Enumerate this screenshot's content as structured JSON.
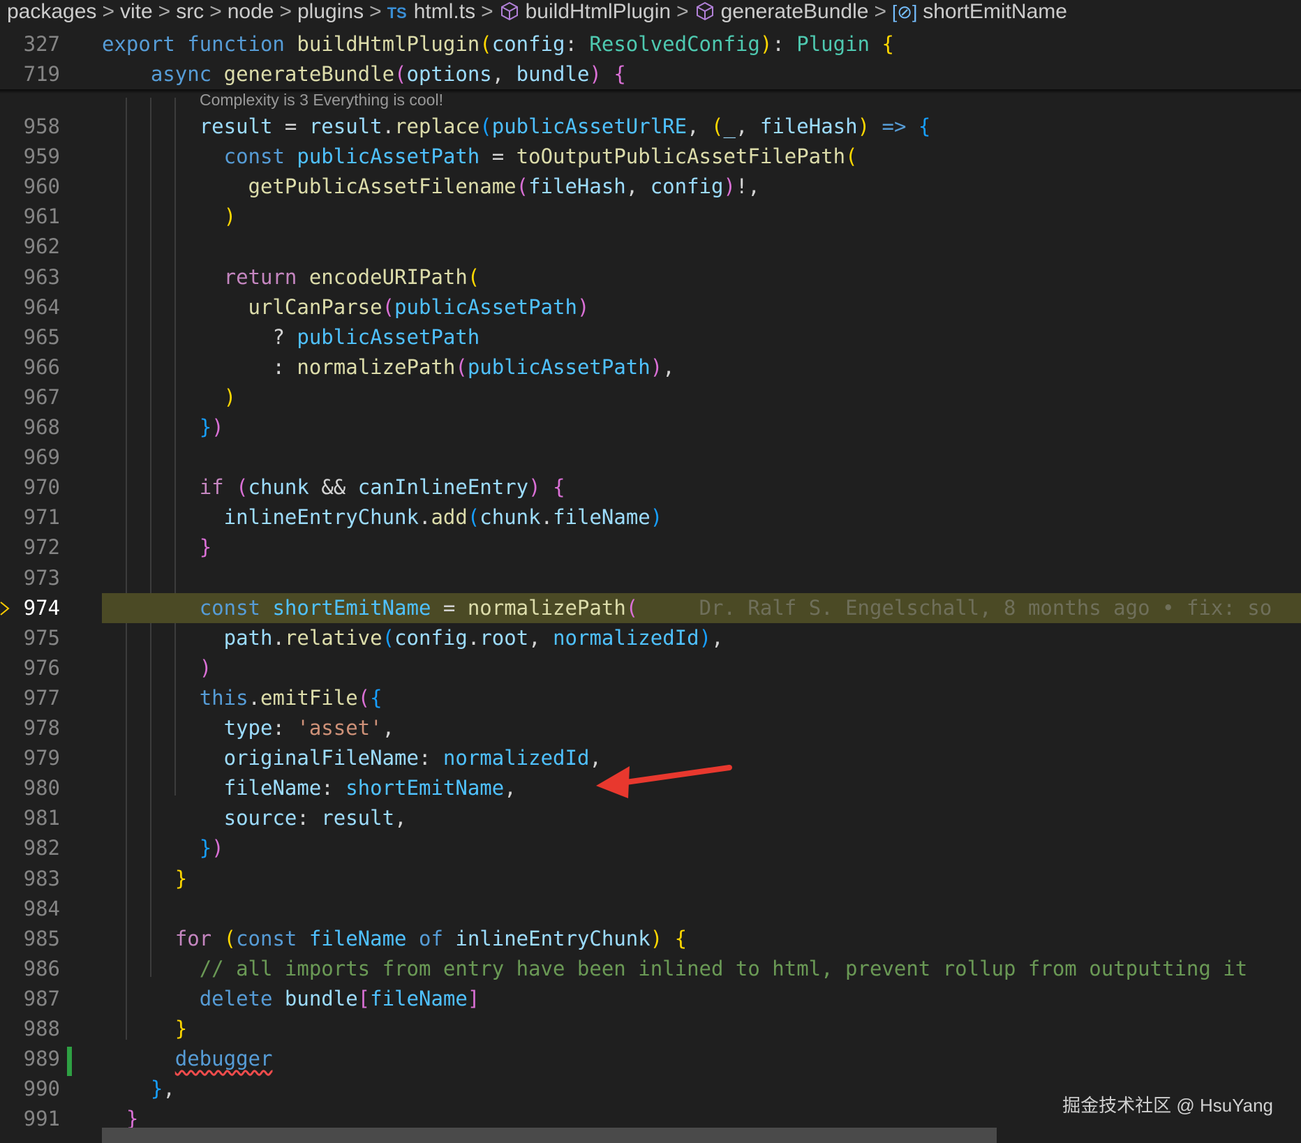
{
  "breadcrumb": {
    "segments": [
      "packages",
      "vite",
      "src",
      "node",
      "plugins",
      "html.ts",
      "buildHtmlPlugin",
      "generateBundle",
      "shortEmitName"
    ],
    "ts_badge": "TS",
    "icons": [
      "",
      "",
      "",
      "",
      "",
      "ts-file-icon",
      "cube-icon",
      "cube-icon",
      "field-icon"
    ]
  },
  "sticky": [
    {
      "num": "327",
      "tokens": [
        [
          "k",
          "export "
        ],
        [
          "k",
          "function "
        ],
        [
          "f",
          "buildHtmlPlugin"
        ],
        [
          "b1",
          "("
        ],
        [
          "v",
          "config"
        ],
        [
          "p",
          ": "
        ],
        [
          "t",
          "ResolvedConfig"
        ],
        [
          "b1",
          ")"
        ],
        [
          "p",
          ": "
        ],
        [
          "t",
          "Plugin "
        ],
        [
          "b1",
          "{"
        ]
      ]
    },
    {
      "num": "719",
      "tokens": [
        [
          "k",
          "async "
        ],
        [
          "f",
          "generateBundle"
        ],
        [
          "b2",
          "("
        ],
        [
          "v",
          "options"
        ],
        [
          "p",
          ", "
        ],
        [
          "v",
          "bundle"
        ],
        [
          "b2",
          ") "
        ],
        [
          "b2",
          "{"
        ]
      ]
    }
  ],
  "codelens": "Complexity is 3 Everything is cool!",
  "lines": [
    {
      "num": "958",
      "tokens": [
        [
          "v",
          "result "
        ],
        [
          "p",
          "= "
        ],
        [
          "v",
          "result"
        ],
        [
          "p",
          "."
        ],
        [
          "f",
          "replace"
        ],
        [
          "b3",
          "("
        ],
        [
          "c",
          "publicAssetUrlRE"
        ],
        [
          "p",
          ", "
        ],
        [
          "b1",
          "("
        ],
        [
          "v",
          "_"
        ],
        [
          "p",
          ", "
        ],
        [
          "v",
          "fileHash"
        ],
        [
          "b1",
          ") "
        ],
        [
          "k",
          "=> "
        ],
        [
          "b3",
          "{"
        ]
      ]
    },
    {
      "num": "959",
      "tokens": [
        [
          "k",
          "const "
        ],
        [
          "c",
          "publicAssetPath "
        ],
        [
          "p",
          "= "
        ],
        [
          "f",
          "toOutputPublicAssetFilePath"
        ],
        [
          "b1",
          "("
        ]
      ]
    },
    {
      "num": "960",
      "tokens": [
        [
          "f",
          "getPublicAssetFilename"
        ],
        [
          "b2",
          "("
        ],
        [
          "v",
          "fileHash"
        ],
        [
          "p",
          ", "
        ],
        [
          "v",
          "config"
        ],
        [
          "b2",
          ")"
        ],
        [
          "p",
          "!,"
        ]
      ]
    },
    {
      "num": "961",
      "tokens": [
        [
          "b1",
          ")"
        ]
      ]
    },
    {
      "num": "962",
      "tokens": []
    },
    {
      "num": "963",
      "tokens": [
        [
          "kp",
          "return "
        ],
        [
          "f",
          "encodeURIPath"
        ],
        [
          "b1",
          "("
        ]
      ]
    },
    {
      "num": "964",
      "tokens": [
        [
          "f",
          "urlCanParse"
        ],
        [
          "b2",
          "("
        ],
        [
          "c",
          "publicAssetPath"
        ],
        [
          "b2",
          ")"
        ]
      ]
    },
    {
      "num": "965",
      "tokens": [
        [
          "p",
          "? "
        ],
        [
          "c",
          "publicAssetPath"
        ]
      ]
    },
    {
      "num": "966",
      "tokens": [
        [
          "p",
          ": "
        ],
        [
          "f",
          "normalizePath"
        ],
        [
          "b2",
          "("
        ],
        [
          "c",
          "publicAssetPath"
        ],
        [
          "b2",
          ")"
        ],
        [
          "p",
          ","
        ]
      ]
    },
    {
      "num": "967",
      "tokens": [
        [
          "b1",
          ")"
        ]
      ]
    },
    {
      "num": "968",
      "tokens": [
        [
          "b3",
          "}"
        ],
        [
          "b2",
          ")"
        ]
      ]
    },
    {
      "num": "969",
      "tokens": []
    },
    {
      "num": "970",
      "tokens": [
        [
          "kp",
          "if "
        ],
        [
          "b2",
          "("
        ],
        [
          "v",
          "chunk "
        ],
        [
          "p",
          "&& "
        ],
        [
          "v",
          "canInlineEntry"
        ],
        [
          "b2",
          ") "
        ],
        [
          "b2",
          "{"
        ]
      ]
    },
    {
      "num": "971",
      "tokens": [
        [
          "v",
          "inlineEntryChunk"
        ],
        [
          "p",
          "."
        ],
        [
          "f",
          "add"
        ],
        [
          "b3",
          "("
        ],
        [
          "v",
          "chunk"
        ],
        [
          "p",
          "."
        ],
        [
          "v",
          "fileName"
        ],
        [
          "b3",
          ")"
        ]
      ]
    },
    {
      "num": "972",
      "tokens": [
        [
          "b2",
          "}"
        ]
      ]
    },
    {
      "num": "973",
      "tokens": []
    },
    {
      "num": "974",
      "tokens": [
        [
          "k",
          "const "
        ],
        [
          "c",
          "shortEmitName "
        ],
        [
          "p",
          "= "
        ],
        [
          "f",
          "normalizePath"
        ],
        [
          "b2",
          "("
        ]
      ],
      "blame": "Dr. Ralf S. Engelschall, 8 months ago • fix: so"
    },
    {
      "num": "975",
      "tokens": [
        [
          "v",
          "path"
        ],
        [
          "p",
          "."
        ],
        [
          "f",
          "relative"
        ],
        [
          "b3",
          "("
        ],
        [
          "v",
          "config"
        ],
        [
          "p",
          "."
        ],
        [
          "v",
          "root"
        ],
        [
          "p",
          ", "
        ],
        [
          "c",
          "normalizedId"
        ],
        [
          "b3",
          ")"
        ],
        [
          "p",
          ","
        ]
      ]
    },
    {
      "num": "976",
      "tokens": [
        [
          "b2",
          ")"
        ]
      ]
    },
    {
      "num": "977",
      "tokens": [
        [
          "k",
          "this"
        ],
        [
          "p",
          "."
        ],
        [
          "f",
          "emitFile"
        ],
        [
          "b2",
          "("
        ],
        [
          "b3",
          "{"
        ]
      ]
    },
    {
      "num": "978",
      "tokens": [
        [
          "v",
          "type"
        ],
        [
          "p",
          ": "
        ],
        [
          "s",
          "'asset'"
        ],
        [
          "p",
          ","
        ]
      ]
    },
    {
      "num": "979",
      "tokens": [
        [
          "v",
          "originalFileName"
        ],
        [
          "p",
          ": "
        ],
        [
          "c",
          "normalizedId"
        ],
        [
          "p",
          ","
        ]
      ]
    },
    {
      "num": "980",
      "tokens": [
        [
          "v",
          "fileName"
        ],
        [
          "p",
          ": "
        ],
        [
          "c",
          "shortEmitName"
        ],
        [
          "p",
          ","
        ]
      ]
    },
    {
      "num": "981",
      "tokens": [
        [
          "v",
          "source"
        ],
        [
          "p",
          ": "
        ],
        [
          "v",
          "result"
        ],
        [
          "p",
          ","
        ]
      ]
    },
    {
      "num": "982",
      "tokens": [
        [
          "b3",
          "}"
        ],
        [
          "b2",
          ")"
        ]
      ]
    },
    {
      "num": "983",
      "tokens": [
        [
          "b1",
          "}"
        ]
      ]
    },
    {
      "num": "984",
      "tokens": []
    },
    {
      "num": "985",
      "tokens": [
        [
          "kp",
          "for "
        ],
        [
          "b1",
          "("
        ],
        [
          "k",
          "const "
        ],
        [
          "c",
          "fileName "
        ],
        [
          "k",
          "of "
        ],
        [
          "v",
          "inlineEntryChunk"
        ],
        [
          "b1",
          ") "
        ],
        [
          "b1",
          "{"
        ]
      ]
    },
    {
      "num": "986",
      "tokens": [
        [
          "cm",
          "// all imports from entry have been inlined to html, prevent rollup from outputting it"
        ]
      ]
    },
    {
      "num": "987",
      "tokens": [
        [
          "k",
          "delete "
        ],
        [
          "v",
          "bundle"
        ],
        [
          "b2",
          "["
        ],
        [
          "c",
          "fileName"
        ],
        [
          "b2",
          "]"
        ]
      ]
    },
    {
      "num": "988",
      "tokens": [
        [
          "b1",
          "}"
        ]
      ]
    },
    {
      "num": "989",
      "tokens": [
        [
          "k",
          "debugger"
        ]
      ]
    },
    {
      "num": "990",
      "tokens": [
        [
          "b3",
          "}"
        ],
        [
          "p",
          ","
        ]
      ]
    },
    {
      "num": "991",
      "tokens": [
        [
          "b2",
          "}"
        ]
      ]
    }
  ],
  "watermark": "掘金技术社区 @ HsuYang",
  "colors": {
    "highlight": "#4b4a25",
    "arrow": "#e8382e",
    "git_added": "#2ea043"
  }
}
